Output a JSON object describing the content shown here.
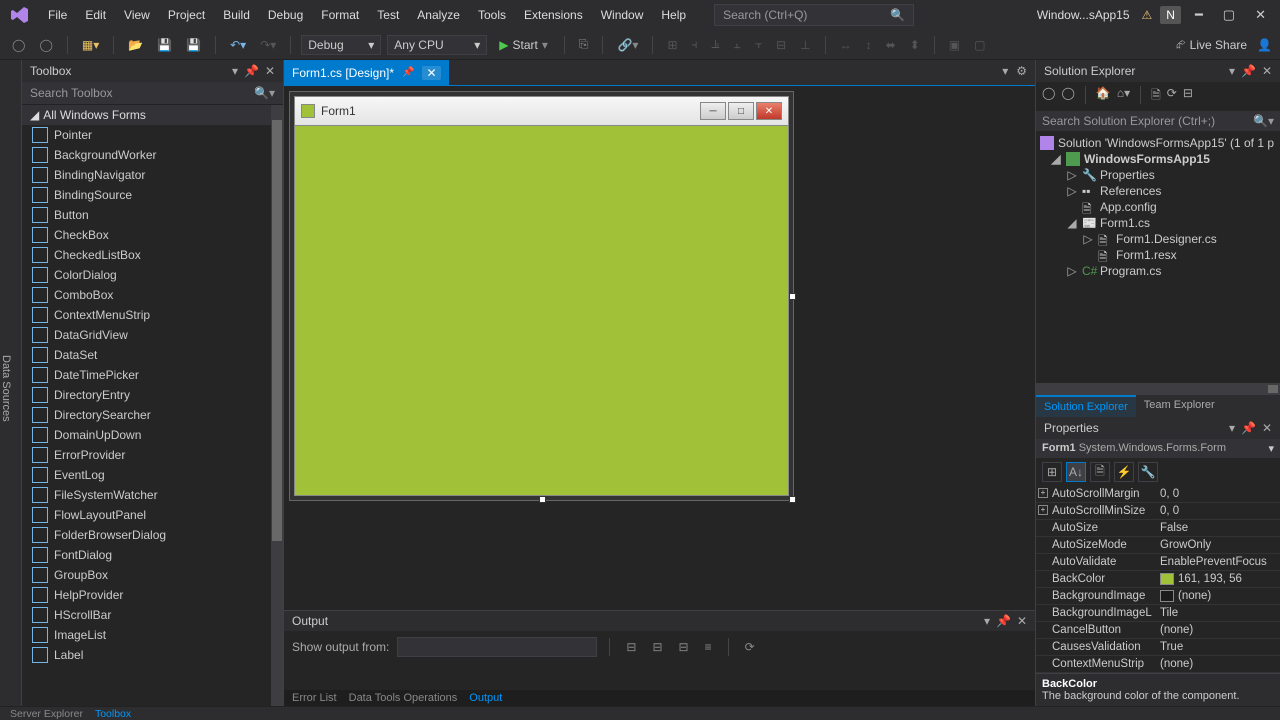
{
  "menu": [
    "File",
    "Edit",
    "View",
    "Project",
    "Build",
    "Debug",
    "Format",
    "Test",
    "Analyze",
    "Tools",
    "Extensions",
    "Window",
    "Help"
  ],
  "search_placeholder": "Search (Ctrl+Q)",
  "app_title": "Window...sApp15",
  "user_badge": "N",
  "toolbar": {
    "config": "Debug",
    "platform": "Any CPU",
    "start": "Start",
    "liveshare": "Live Share"
  },
  "side_tab": "Data Sources",
  "toolbox": {
    "title": "Toolbox",
    "search": "Search Toolbox",
    "group": "All Windows Forms",
    "items": [
      "Pointer",
      "BackgroundWorker",
      "BindingNavigator",
      "BindingSource",
      "Button",
      "CheckBox",
      "CheckedListBox",
      "ColorDialog",
      "ComboBox",
      "ContextMenuStrip",
      "DataGridView",
      "DataSet",
      "DateTimePicker",
      "DirectoryEntry",
      "DirectorySearcher",
      "DomainUpDown",
      "ErrorProvider",
      "EventLog",
      "FileSystemWatcher",
      "FlowLayoutPanel",
      "FolderBrowserDialog",
      "FontDialog",
      "GroupBox",
      "HelpProvider",
      "HScrollBar",
      "ImageList",
      "Label"
    ]
  },
  "doc_tab": "Form1.cs [Design]*",
  "form_title": "Form1",
  "output": {
    "title": "Output",
    "label": "Show output from:"
  },
  "bottom_tabs": [
    "Error List",
    "Data Tools Operations",
    "Output"
  ],
  "bottom_tabs_left": [
    "Server Explorer",
    "Toolbox"
  ],
  "solution": {
    "title": "Solution Explorer",
    "search": "Search Solution Explorer (Ctrl+;)",
    "root": "Solution 'WindowsFormsApp15' (1 of 1 p",
    "project": "WindowsFormsApp15",
    "nodes": [
      "Properties",
      "References",
      "App.config",
      "Form1.cs",
      "Form1.Designer.cs",
      "Form1.resx",
      "Program.cs"
    ],
    "tabs": [
      "Solution Explorer",
      "Team Explorer"
    ]
  },
  "properties": {
    "title": "Properties",
    "object": "Form1",
    "type": "System.Windows.Forms.Form",
    "rows": [
      {
        "n": "AutoScrollMargin",
        "v": "0, 0",
        "exp": true
      },
      {
        "n": "AutoScrollMinSize",
        "v": "0, 0",
        "exp": true
      },
      {
        "n": "AutoSize",
        "v": "False"
      },
      {
        "n": "AutoSizeMode",
        "v": "GrowOnly"
      },
      {
        "n": "AutoValidate",
        "v": "EnablePreventFocus"
      },
      {
        "n": "BackColor",
        "v": "161, 193, 56",
        "color": "#a1c138"
      },
      {
        "n": "BackgroundImage",
        "v": "(none)",
        "color": "#1b1b1b"
      },
      {
        "n": "BackgroundImageL",
        "v": "Tile"
      },
      {
        "n": "CancelButton",
        "v": "(none)"
      },
      {
        "n": "CausesValidation",
        "v": "True"
      },
      {
        "n": "ContextMenuStrip",
        "v": "(none)"
      }
    ],
    "desc_name": "BackColor",
    "desc_text": "The background color of the component."
  }
}
